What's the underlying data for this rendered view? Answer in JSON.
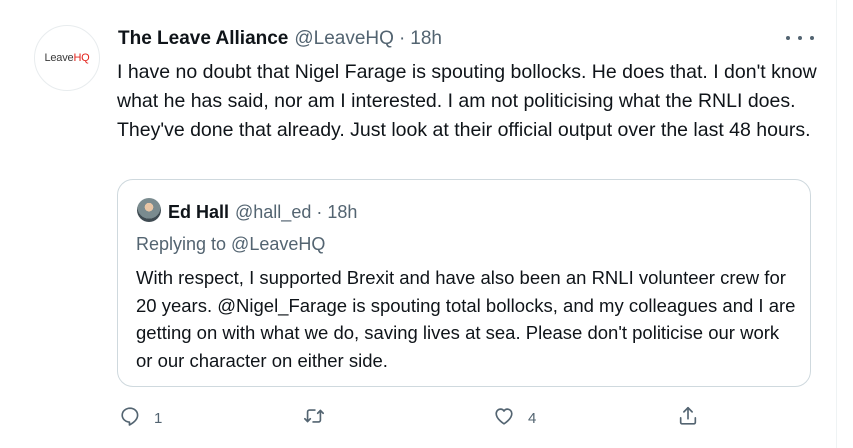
{
  "tweet": {
    "avatar": {
      "text_left": "Leave",
      "text_right": "HQ"
    },
    "display_name": "The Leave Alliance",
    "handle": "@LeaveHQ",
    "separator": "·",
    "time": "18h",
    "more_icon": "more-horizontal-icon",
    "text": "I have no doubt that Nigel Farage is spouting bollocks. He does that. I don't know what he has said, nor am I interested. I am not politicising what the RNLI does. They've done that already. Just look at their official output over the last 48 hours."
  },
  "quote": {
    "display_name": "Ed Hall",
    "handle": "@hall_ed",
    "separator": "·",
    "time": "18h",
    "replying_to": "Replying to @LeaveHQ",
    "text": "With respect, I supported Brexit and have also been an RNLI volunteer crew for 20 years. @Nigel_Farage is spouting total bollocks, and my colleagues and I are getting on with what we do, saving lives at sea. Please don't politicise our work or our character on either side."
  },
  "actions": {
    "reply": {
      "icon": "reply-icon",
      "count": "1"
    },
    "retweet": {
      "icon": "retweet-icon",
      "count": ""
    },
    "like": {
      "icon": "heart-icon",
      "count": "4"
    },
    "share": {
      "icon": "share-icon",
      "count": ""
    }
  },
  "colors": {
    "text": "#0f1419",
    "secondary": "#536471",
    "border": "#cfd9de",
    "avatar_hq": "#e3231b"
  }
}
